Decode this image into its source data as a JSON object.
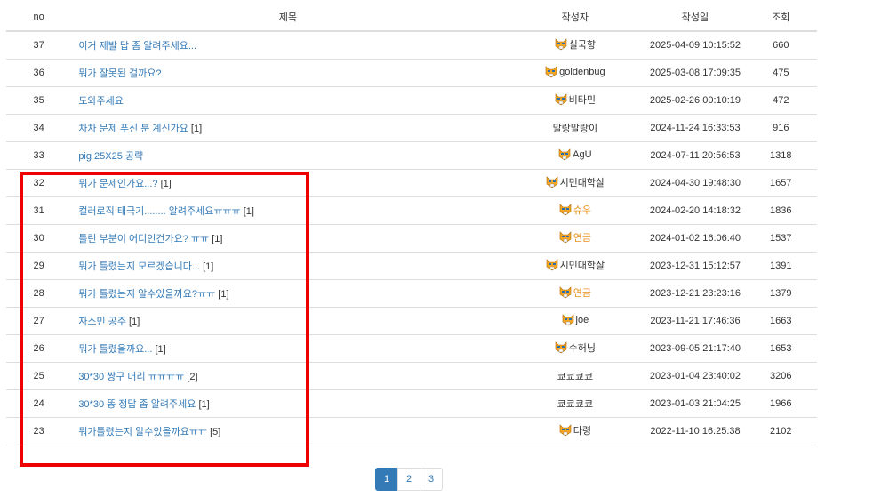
{
  "table": {
    "headers": {
      "no": "no",
      "title": "제목",
      "author": "작성자",
      "date": "작성일",
      "views": "조회"
    },
    "rows": [
      {
        "no": "37",
        "title": "이거 제발 답 좀 알려주세요...",
        "comments": "",
        "author": "실국향",
        "author_color": "normal",
        "has_icon": true,
        "date": "2025-04-09 10:15:52",
        "views": "660"
      },
      {
        "no": "36",
        "title": "뭐가 잘못된 걸까요?",
        "comments": "",
        "author": "goldenbug",
        "author_color": "normal",
        "has_icon": true,
        "date": "2025-03-08 17:09:35",
        "views": "475"
      },
      {
        "no": "35",
        "title": "도와주세요",
        "comments": "",
        "author": "비타민",
        "author_color": "normal",
        "has_icon": true,
        "date": "2025-02-26 00:10:19",
        "views": "472"
      },
      {
        "no": "34",
        "title": "차차 문제 푸신 분 계신가요",
        "comments": "[1]",
        "author": "말랑말랑이",
        "author_color": "normal",
        "has_icon": false,
        "date": "2024-11-24 16:33:53",
        "views": "916"
      },
      {
        "no": "33",
        "title": "pig 25X25 공략",
        "comments": "",
        "author": "AgU",
        "author_color": "normal",
        "has_icon": true,
        "date": "2024-07-11 20:56:53",
        "views": "1318"
      },
      {
        "no": "32",
        "title": "뭐가 문제인가요...?",
        "comments": "[1]",
        "author": "시민대학살",
        "author_color": "normal",
        "has_icon": true,
        "date": "2024-04-30 19:48:30",
        "views": "1657"
      },
      {
        "no": "31",
        "title": "컬러로직 태극기........ 알려주세요ㅠㅠㅠ",
        "comments": "[1]",
        "author": "슈우",
        "author_color": "orange",
        "has_icon": true,
        "date": "2024-02-20 14:18:32",
        "views": "1836"
      },
      {
        "no": "30",
        "title": "틀린 부분이 어디인건가요? ㅠㅠ",
        "comments": "[1]",
        "author": "연금",
        "author_color": "orange",
        "has_icon": true,
        "date": "2024-01-02 16:06:40",
        "views": "1537"
      },
      {
        "no": "29",
        "title": "뭐가 틀렸는지 모르겠습니다...",
        "comments": "[1]",
        "author": "시민대학살",
        "author_color": "normal",
        "has_icon": true,
        "date": "2023-12-31 15:12:57",
        "views": "1391"
      },
      {
        "no": "28",
        "title": "뭐가 틀렸는지 알수있을까요?ㅠㅠ",
        "comments": "[1]",
        "author": "연금",
        "author_color": "orange",
        "has_icon": true,
        "date": "2023-12-21 23:23:16",
        "views": "1379"
      },
      {
        "no": "27",
        "title": "자스민 공주",
        "comments": "[1]",
        "author": "joe",
        "author_color": "normal",
        "has_icon": true,
        "date": "2023-11-21 17:46:36",
        "views": "1663"
      },
      {
        "no": "26",
        "title": "뭐가 틀렸을까요...",
        "comments": "[1]",
        "author": "수허닝",
        "author_color": "normal",
        "has_icon": true,
        "date": "2023-09-05 21:17:40",
        "views": "1653"
      },
      {
        "no": "25",
        "title": "30*30 쌍구 머리 ㅠㅠㅠㅠ",
        "comments": "[2]",
        "author": "쿄쿄쿄쿄",
        "author_color": "normal",
        "has_icon": false,
        "date": "2023-01-04 23:40:02",
        "views": "3206"
      },
      {
        "no": "24",
        "title": "30*30 똥 정답 좀 알려주세요",
        "comments": "[1]",
        "author": "쿄쿄쿄쿄",
        "author_color": "normal",
        "has_icon": false,
        "date": "2023-01-03 21:04:25",
        "views": "1966"
      },
      {
        "no": "23",
        "title": "뭐가틀렸는지 알수있을까요ㅠㅠ",
        "comments": "[5]",
        "author": "다령",
        "author_color": "normal",
        "has_icon": true,
        "date": "2022-11-10 16:25:38",
        "views": "2102"
      }
    ]
  },
  "pagination": {
    "pages": [
      "1",
      "2",
      "3"
    ],
    "active": "1"
  },
  "colors": {
    "link": "#337ab7",
    "author_orange": "#e8901c",
    "highlight": "#ee0000"
  },
  "icons": {
    "author_level": "cat-face-icon"
  }
}
